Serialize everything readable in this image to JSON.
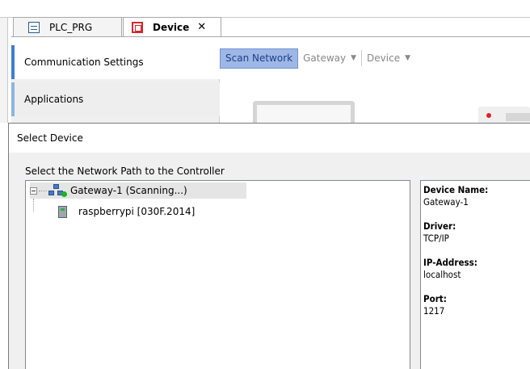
{
  "tabs": [
    {
      "label": "PLC_PRG",
      "icon": "document-icon"
    },
    {
      "label": "Device",
      "icon": "device-icon",
      "close": "✕"
    }
  ],
  "leftnav": {
    "items": [
      "Communication Settings",
      "Applications"
    ]
  },
  "toolbar": {
    "scan_label": "Scan Network",
    "gateway_label": "Gateway",
    "device_label": "Device"
  },
  "dialog": {
    "title": "Select Device",
    "prompt": "Select the Network Path to the Controller",
    "tree": {
      "gateway": "Gateway-1 (Scanning...)",
      "device": "raspberrypi [030F.2014]"
    },
    "info": [
      {
        "label": "Device Name:",
        "value": "Gateway-1"
      },
      {
        "label": "Driver:",
        "value": "TCP/IP"
      },
      {
        "label": "IP-Address:",
        "value": "localhost"
      },
      {
        "label": "Port:",
        "value": "1217"
      }
    ]
  },
  "colors": {
    "accent": "#3c7fd0",
    "scan_button": "#9fb7e6",
    "status_ok": "#1fb31f",
    "device_tab": "#d7262f"
  }
}
